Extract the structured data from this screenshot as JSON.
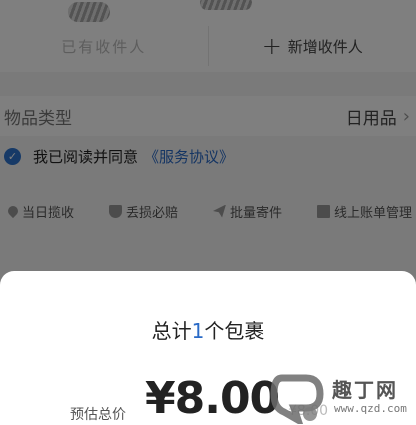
{
  "header": {
    "left_action": "已有收件人",
    "right_action_icon": "plus-icon",
    "right_action": "新增收件人"
  },
  "item_type": {
    "label": "物品类型",
    "value": "日用品"
  },
  "agreement": {
    "checked": true,
    "text": "我已阅读并同意",
    "link": "《服务协议》"
  },
  "features": [
    {
      "icon": "pin-icon",
      "label": "当日揽收"
    },
    {
      "icon": "shield-icon",
      "label": "丢损必赔"
    },
    {
      "icon": "plane-icon",
      "label": "批量寄件"
    },
    {
      "icon": "document-icon",
      "label": "线上账单管理"
    }
  ],
  "sheet": {
    "total_prefix": "总计",
    "total_count": "1",
    "total_suffix": "个包裹",
    "price_label": "预估总价",
    "price": "¥8.00",
    "original_price": "¥8.00"
  },
  "watermark": {
    "title": "趣丁网",
    "url": "www.qzd.com"
  },
  "colors": {
    "accent": "#2a6ac7",
    "overlay": "rgba(0,0,0,0.5)"
  }
}
